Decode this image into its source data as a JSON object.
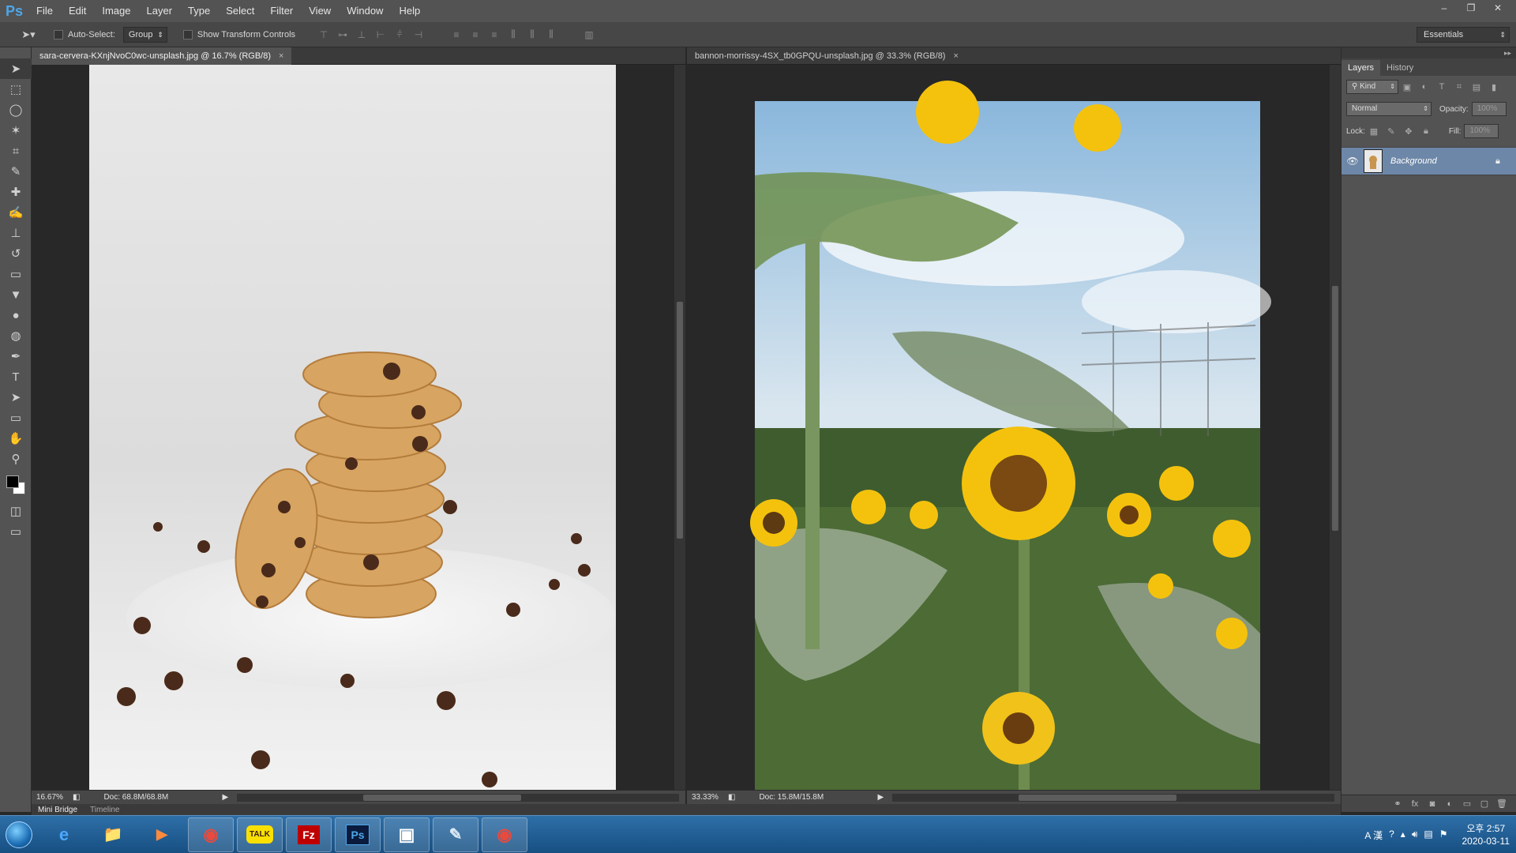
{
  "app": {
    "logo": "Ps"
  },
  "menu": [
    "File",
    "Edit",
    "Image",
    "Layer",
    "Type",
    "Select",
    "Filter",
    "View",
    "Window",
    "Help"
  ],
  "window_controls": {
    "minimize": "–",
    "restore": "❐",
    "close": "✕"
  },
  "options_bar": {
    "auto_select_label": "Auto-Select:",
    "auto_select_value": "Group",
    "transform_label": "Show Transform Controls",
    "workspace": "Essentials"
  },
  "toolbox": {
    "tools": [
      "move-tool",
      "marquee-tool",
      "lasso-tool",
      "magic-wand-tool",
      "crop-tool",
      "eyedropper-tool",
      "healing-brush-tool",
      "brush-tool",
      "clone-stamp-tool",
      "history-brush-tool",
      "eraser-tool",
      "paint-bucket-tool",
      "blur-tool",
      "dodge-tool",
      "pen-tool",
      "type-tool",
      "path-selection-tool",
      "rectangle-tool",
      "hand-tool",
      "zoom-tool"
    ],
    "glyphs": [
      "➤",
      "⬚",
      "◯",
      "✶",
      "⌗",
      "✎",
      "✚",
      "✍",
      "⊥",
      "↺",
      "▭",
      "▼",
      "●",
      "◍",
      "✒",
      "T",
      "➤",
      "▭",
      "✋",
      "⚲"
    ],
    "colors": {
      "foreground": "#000000",
      "background": "#ffffff"
    }
  },
  "docs": [
    {
      "tab_title": "sara-cervera-KXnjNvoC0wc-unsplash.jpg @ 16.7% (RGB/8)",
      "close": "×",
      "zoom": "16.67%",
      "doc_info": "Doc: 68.8M/68.8M"
    },
    {
      "tab_title": "bannon-morrissy-4SX_tb0GPQU-unsplash.jpg @ 33.3% (RGB/8)",
      "close": "×",
      "zoom": "33.33%",
      "doc_info": "Doc: 15.8M/15.8M"
    }
  ],
  "layers_panel": {
    "tabs": [
      "Layers",
      "History"
    ],
    "kind_label": "Kind",
    "blend_mode": "Normal",
    "opacity_label": "Opacity:",
    "opacity_value": "100%",
    "lock_label": "Lock:",
    "fill_label": "Fill:",
    "fill_value": "100%",
    "layers": [
      {
        "name": "Background",
        "visible": true,
        "locked": true
      }
    ]
  },
  "bottom_tabs": [
    "Mini Bridge",
    "Timeline"
  ],
  "taskbar": {
    "apps": [
      "internet-explorer",
      "file-explorer",
      "media-player",
      "chrome",
      "kakaotalk",
      "filezilla",
      "photoshop",
      "app-window",
      "notepad",
      "chrome"
    ],
    "labels": [
      "e",
      "📁",
      "▶",
      "◉",
      "TALK",
      "Fz",
      "Ps",
      "▣",
      "✎",
      "◉"
    ],
    "tray_text": "A 漢",
    "time": "오후 2:57",
    "date": "2020-03-11"
  }
}
